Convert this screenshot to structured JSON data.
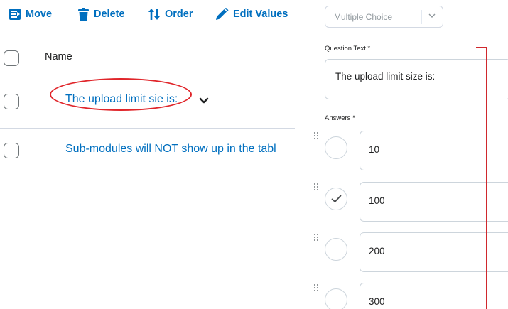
{
  "toolbar": {
    "move": "Move",
    "delete": "Delete",
    "order": "Order",
    "edit_values": "Edit Values"
  },
  "grid": {
    "column_name": "Name",
    "rows": [
      {
        "title": "The upload limit sie is:"
      },
      {
        "title": "Sub-modules will NOT show up in the tabl"
      }
    ]
  },
  "editor": {
    "question_type": "Multiple Choice",
    "question_text_label": "Question Text *",
    "question_text": "The upload limit size is:",
    "answers_label": "Answers *",
    "answers": [
      {
        "text": "10",
        "correct": false
      },
      {
        "text": "100",
        "correct": true
      },
      {
        "text": "200",
        "correct": false
      },
      {
        "text": "300",
        "correct": false
      }
    ]
  },
  "colors": {
    "link": "#006fbf",
    "annotation": "#e0262b",
    "border": "#d3d9e3",
    "text": "#202122"
  }
}
